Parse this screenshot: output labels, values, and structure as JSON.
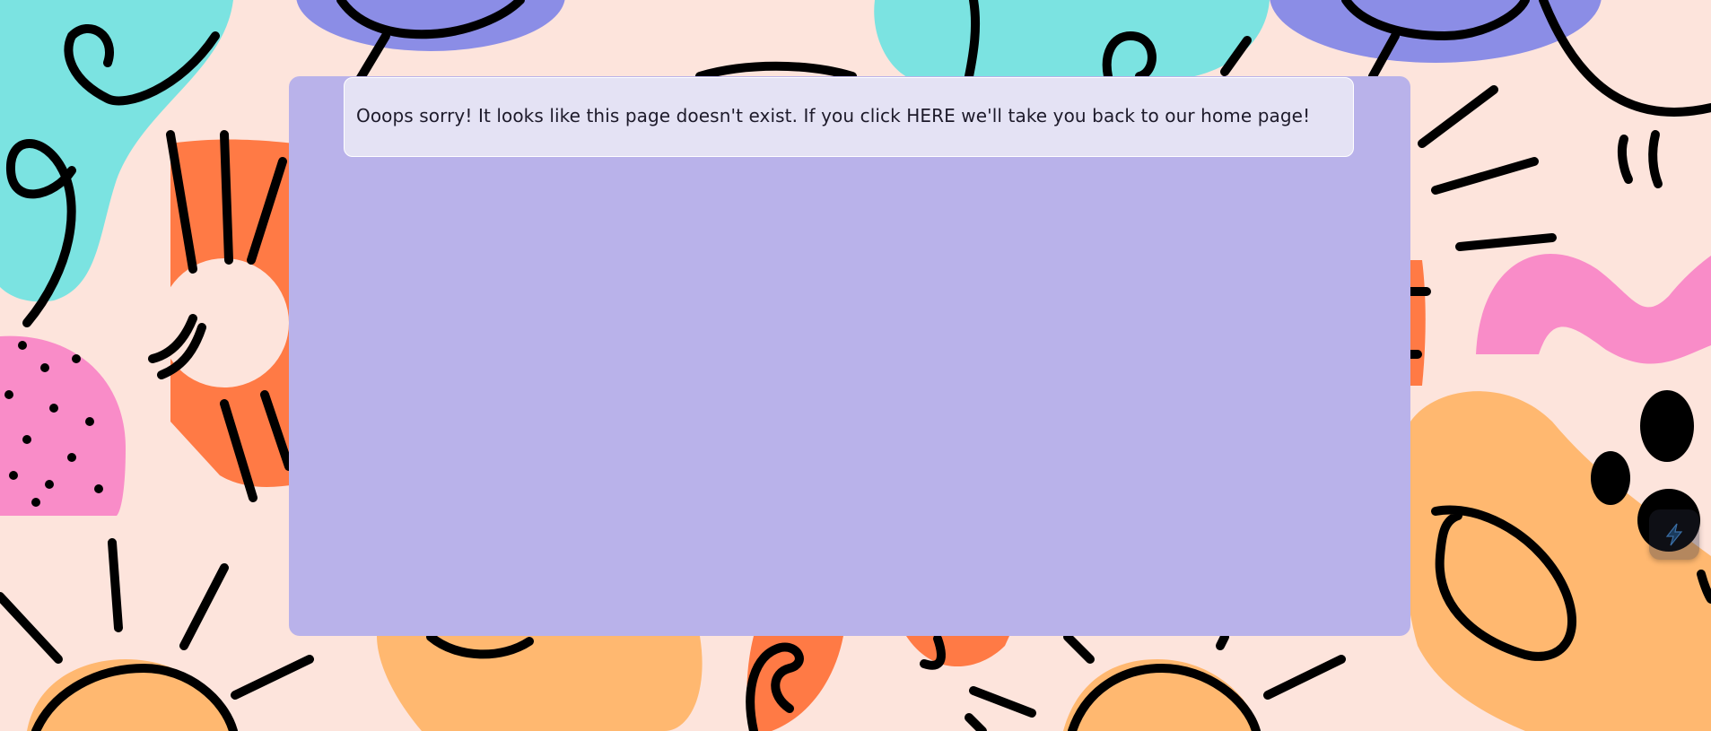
{
  "page": {
    "message": "Ooops sorry! It looks like this page doesn't exist. If you click HERE we'll take you back to our home page!"
  },
  "colors": {
    "background": "#fde4dc",
    "panel": "#b9b2ea",
    "notice": "#e4e2f4",
    "cyan": "#7be3e1",
    "blue": "#8b8de6",
    "orange": "#ff7a45",
    "peach": "#ffb870",
    "pink": "#f98cc8",
    "ink": "#000000"
  },
  "widget": {
    "icon": "lightning-icon"
  }
}
